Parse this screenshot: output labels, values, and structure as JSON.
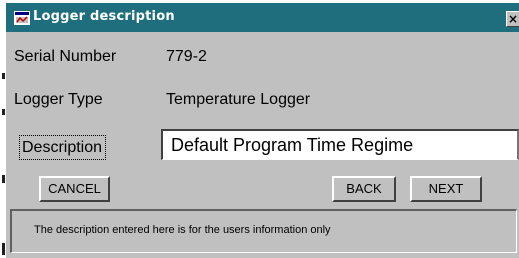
{
  "window": {
    "title": "Logger description",
    "close_glyph": "×",
    "title_color": "#1e6e7e"
  },
  "fields": {
    "serial_label": "Serial Number",
    "serial_value": "779-2",
    "type_label": "Logger Type",
    "type_value": "Temperature Logger",
    "description_label": "Description",
    "description_value": "Default Program Time Regime"
  },
  "buttons": {
    "cancel": "CANCEL",
    "back": "BACK",
    "next": "NEXT"
  },
  "status": {
    "text": "The description entered here is for the users information only"
  }
}
